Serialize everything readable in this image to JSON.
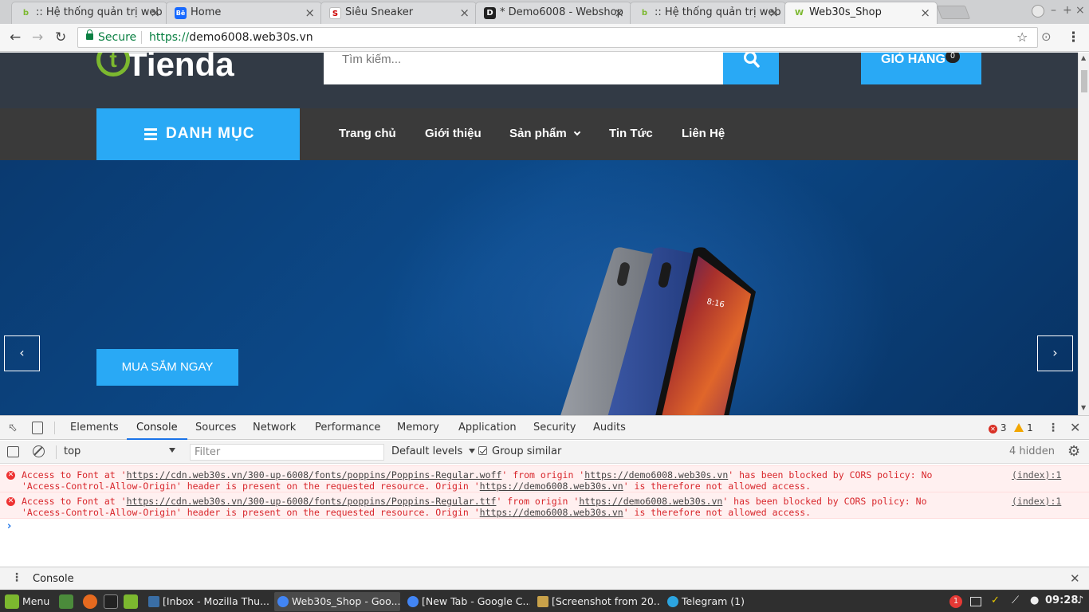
{
  "browser": {
    "tabs": [
      {
        "title": ":: Hệ thống quản trị web",
        "favicon": "b",
        "fav_color": "#7cb82f",
        "active": false
      },
      {
        "title": "Home",
        "favicon": "Bē",
        "fav_color": "#1769ff",
        "active": false
      },
      {
        "title": "Siêu Sneaker",
        "favicon": "S",
        "fav_color": "#ffffff",
        "active": false
      },
      {
        "title": "* Demo6008 - Webshop",
        "favicon": "D",
        "fav_color": "#222222",
        "active": false
      },
      {
        "title": ":: Hệ thống quản trị web",
        "favicon": "b",
        "fav_color": "#7cb82f",
        "active": false
      },
      {
        "title": "Web30s_Shop",
        "favicon": "W",
        "fav_color": "#7cb82f",
        "active": true
      }
    ],
    "tab_close": "×",
    "window_controls": [
      "–",
      "+",
      "×"
    ],
    "secure_label": "Secure",
    "url_scheme": "https://",
    "url_host": "demo6008.web30s.vn",
    "star_icon": "☆",
    "camera_icon": "⊙",
    "menu_icon": "⋮"
  },
  "site": {
    "logo_text": "Tienda",
    "search_placeholder": "Tìm kiếm...",
    "cart_label": "GIỎ HÀNG",
    "cart_count": "0",
    "category_button": "DANH MỤC",
    "menu": [
      "Trang chủ",
      "Giới thiệu",
      "Sản phẩm",
      "Tin Tức",
      "Liên Hệ"
    ],
    "prev_arrow": "‹",
    "next_arrow": "›",
    "cta_button": "MUA SẮM NGAY",
    "brand_color": "#29a9f5",
    "logo_color": "#7cb82f"
  },
  "devtools": {
    "tabs": [
      "Elements",
      "Console",
      "Sources",
      "Network",
      "Performance",
      "Memory",
      "Application",
      "Security",
      "Audits"
    ],
    "active_tab": "Console",
    "error_count": "3",
    "warning_count": "1",
    "context": "top",
    "filter_placeholder": "Filter",
    "levels": "Default levels",
    "group_similar": "Group similar",
    "hidden_count": "4 hidden",
    "messages": [
      {
        "pre1": "Access to Font at '",
        "link1": "https://cdn.web30s.vn/300-up-6008/fonts/poppins/Poppins-Regular.woff",
        "mid1": "' from origin '",
        "link2": "https://demo6008.web30s.vn",
        "post1": "' has been blocked by CORS policy: No",
        "pre2": "'Access-Control-Allow-Origin' header is present on the requested resource. Origin '",
        "link3": "https://demo6008.web30s.vn",
        "post2": "' is therefore not allowed access.",
        "source": "(index):1"
      },
      {
        "pre1": "Access to Font at '",
        "link1": "https://cdn.web30s.vn/300-up-6008/fonts/poppins/Poppins-Regular.ttf",
        "mid1": "' from origin '",
        "link2": "https://demo6008.web30s.vn",
        "post1": "' has been blocked by CORS policy: No",
        "pre2": "'Access-Control-Allow-Origin' header is present on the requested resource. Origin '",
        "link3": "https://demo6008.web30s.vn",
        "post2": "' is therefore not allowed access.",
        "source": "(index):1"
      }
    ],
    "prompt": "›",
    "drawer_label": "Console"
  },
  "taskbar": {
    "menu_label": "Menu",
    "windows": [
      {
        "title": "[Inbox - Mozilla Thu...",
        "color": "#3a6ea5",
        "active": false
      },
      {
        "title": "Web30s_Shop - Goo...",
        "color": "#4285f4",
        "active": true
      },
      {
        "title": "[New Tab - Google C...",
        "color": "#4285f4",
        "active": false
      },
      {
        "title": "[Screenshot from 20...",
        "color": "#c9a24a",
        "active": false
      },
      {
        "title": "Telegram (1)",
        "color": "#2ca5e0",
        "active": false
      }
    ],
    "notification_badge": "1",
    "clock": "09:28"
  }
}
